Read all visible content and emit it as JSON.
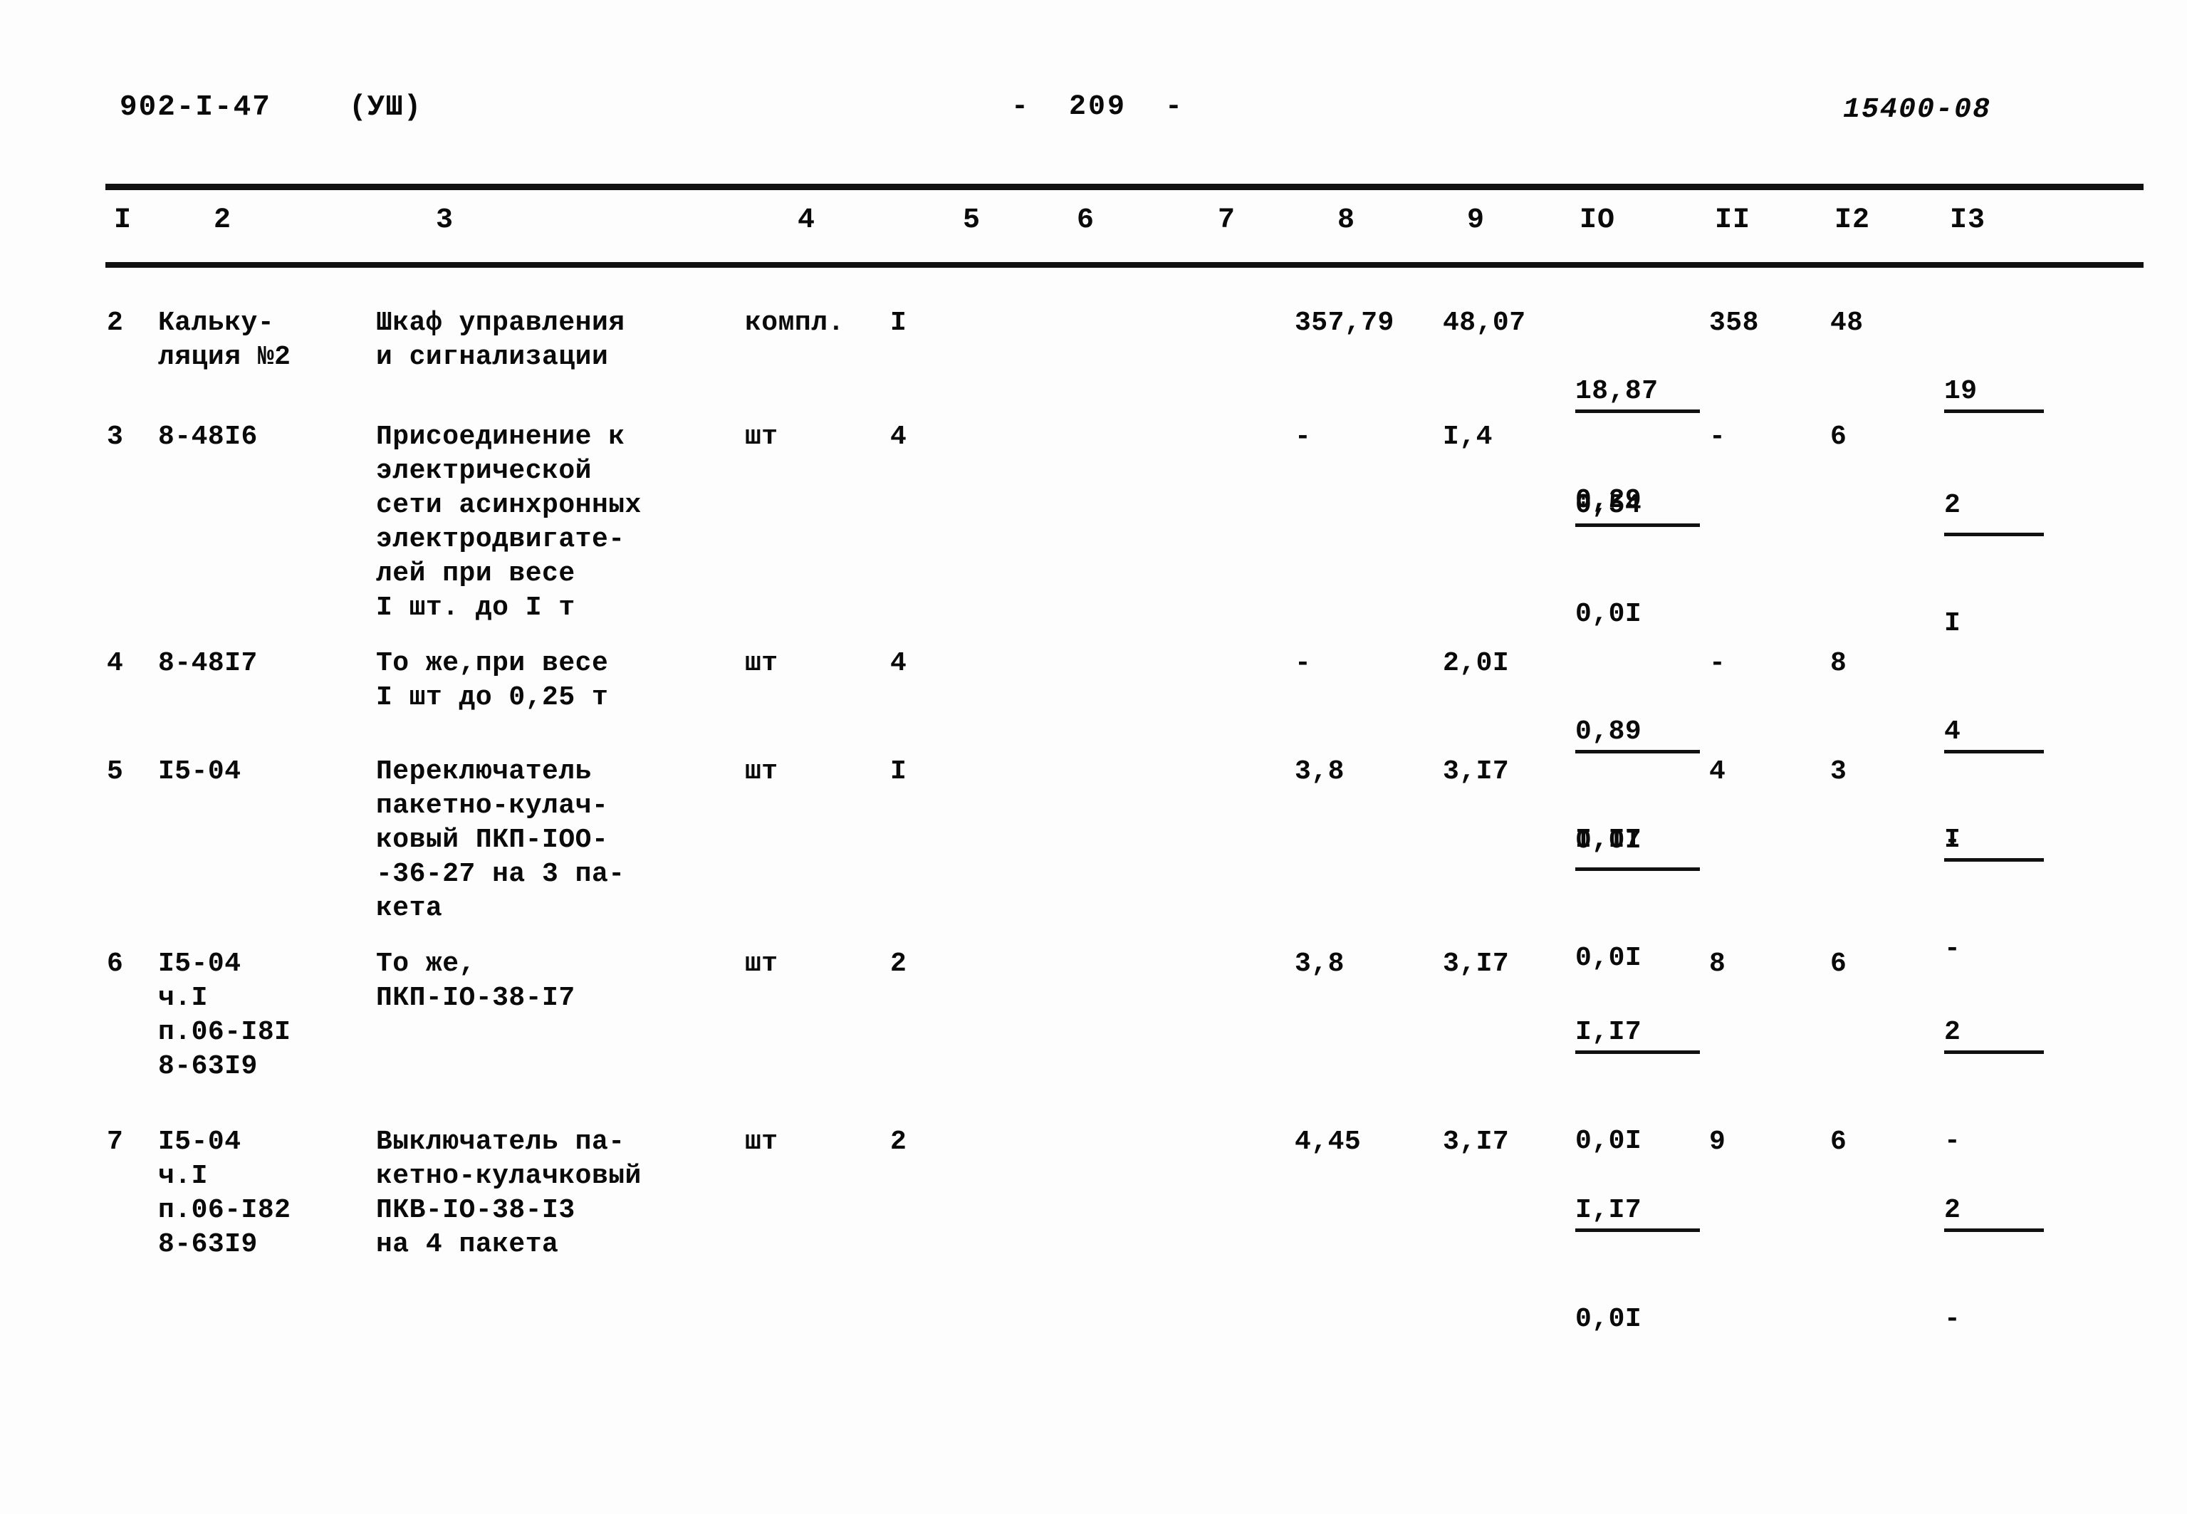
{
  "header": {
    "doc_code": "902-I-47",
    "doc_variant": "(УШ)",
    "page_number": "-  209  -",
    "sheet_code": "15400-08"
  },
  "table": {
    "column_headers": [
      "I",
      "2",
      "3",
      "4",
      "5",
      "6",
      "7",
      "8",
      "9",
      "IO",
      "II",
      "I2",
      "I3"
    ],
    "rows": [
      {
        "num": "2",
        "code": "Кальку-\nляция №2",
        "desc": "Шкаф управления\nи сигнализации",
        "unit": "компл.",
        "qty": "I",
        "c6": "",
        "c7": "",
        "c8": "357,79",
        "c9": "48,07",
        "c10_num": "18,87",
        "c10_den": "0,29",
        "c11": "358",
        "c12": "48",
        "c13_num": "19",
        "c13_den": ""
      },
      {
        "num": "3",
        "code": "8-48I6",
        "desc": "Присоединение к\nэлектрической\nсети асинхронных\nэлектродвигате-\nлей при весе\nI шт. до I т",
        "unit": "шт",
        "qty": "4",
        "c6": "",
        "c7": "",
        "c8": "-",
        "c9": "I,4",
        "c10_num": "0,54",
        "c10_den": "0,0I",
        "c11": "-",
        "c12": "6",
        "c13_num": "2",
        "c13_den": "I"
      },
      {
        "num": "4",
        "code": "8-48I7",
        "desc": "То же,при весе\nI шт до 0,25 т",
        "unit": "шт",
        "qty": "4",
        "c6": "",
        "c7": "",
        "c8": "-",
        "c9": "2,0I",
        "c10_num": "0,89",
        "c10_den": "0,0I",
        "c11": "-",
        "c12": "8",
        "c13_num": "4",
        "c13_den": "-"
      },
      {
        "num": "5",
        "code": "I5-04",
        "desc": "Переключатель\nпакетно-кулач-\nковый ПКП-IOO-\n-36-27 на 3 па-\nкета",
        "unit": "шт",
        "qty": "I",
        "c6": "",
        "c7": "",
        "c8": "3,8",
        "c9": "3,I7",
        "c10_num": "I,I7",
        "c10_den": "0,0I",
        "c11": "4",
        "c12": "3",
        "c13_num": "I",
        "c13_den": "-"
      },
      {
        "num": "6",
        "code": "I5-04\nч.I\nп.06-I8I\n8-63I9",
        "desc": "То же,\nПКП-IO-38-I7",
        "unit": "шт",
        "qty": "2",
        "c6": "",
        "c7": "",
        "c8": "3,8",
        "c9": "3,I7",
        "c10_num": "I,I7",
        "c10_den": "0,0I",
        "c11": "8",
        "c12": "6",
        "c13_num": "2",
        "c13_den": "-"
      },
      {
        "num": "7",
        "code": "I5-04\nч.I\nп.06-I82\n8-63I9",
        "desc": "Выключатель па-\nкетно-кулачковый\nПКВ-IO-38-I3\nна 4 пакета",
        "unit": "шт",
        "qty": "2",
        "c6": "",
        "c7": "",
        "c8": "4,45",
        "c9": "3,I7",
        "c10_num": "I,I7",
        "c10_den": "0,0I",
        "c11": "9",
        "c12": "6",
        "c13_num": "2",
        "c13_den": "-"
      }
    ]
  }
}
